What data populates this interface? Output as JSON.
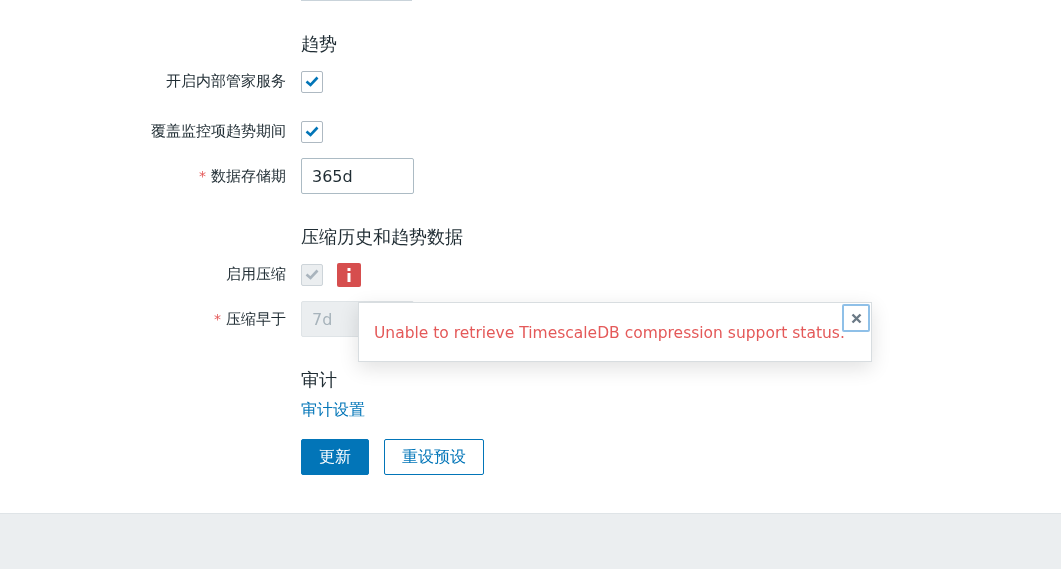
{
  "rows": [
    {
      "kind": "cut-field"
    },
    {
      "kind": "heading",
      "text": "趋势"
    },
    {
      "kind": "checkbox",
      "label": "开启内部管家服务",
      "checked": true,
      "disabled": false,
      "warning": false
    },
    {
      "kind": "checkbox",
      "label": "覆盖监控项趋势期间",
      "checked": true,
      "disabled": false,
      "warning": false
    },
    {
      "kind": "input",
      "label": "数据存储期",
      "required_mark": "*",
      "value": "365d",
      "disabled": false
    },
    {
      "kind": "heading",
      "text": "压缩历史和趋势数据"
    },
    {
      "kind": "checkbox",
      "label": "启用压缩",
      "checked": true,
      "disabled": true,
      "warning": true
    },
    {
      "kind": "input",
      "label": "压缩早于",
      "required_mark": "*",
      "value": "7d",
      "disabled": true
    },
    {
      "kind": "heading",
      "text": "审计"
    },
    {
      "kind": "link",
      "text": "审计设置"
    }
  ],
  "buttons": [
    {
      "label": "更新",
      "primary": true
    },
    {
      "label": "重设预设",
      "primary": false
    }
  ],
  "popup": {
    "message": "Unable to retrieve TimescaleDB compression support status."
  }
}
